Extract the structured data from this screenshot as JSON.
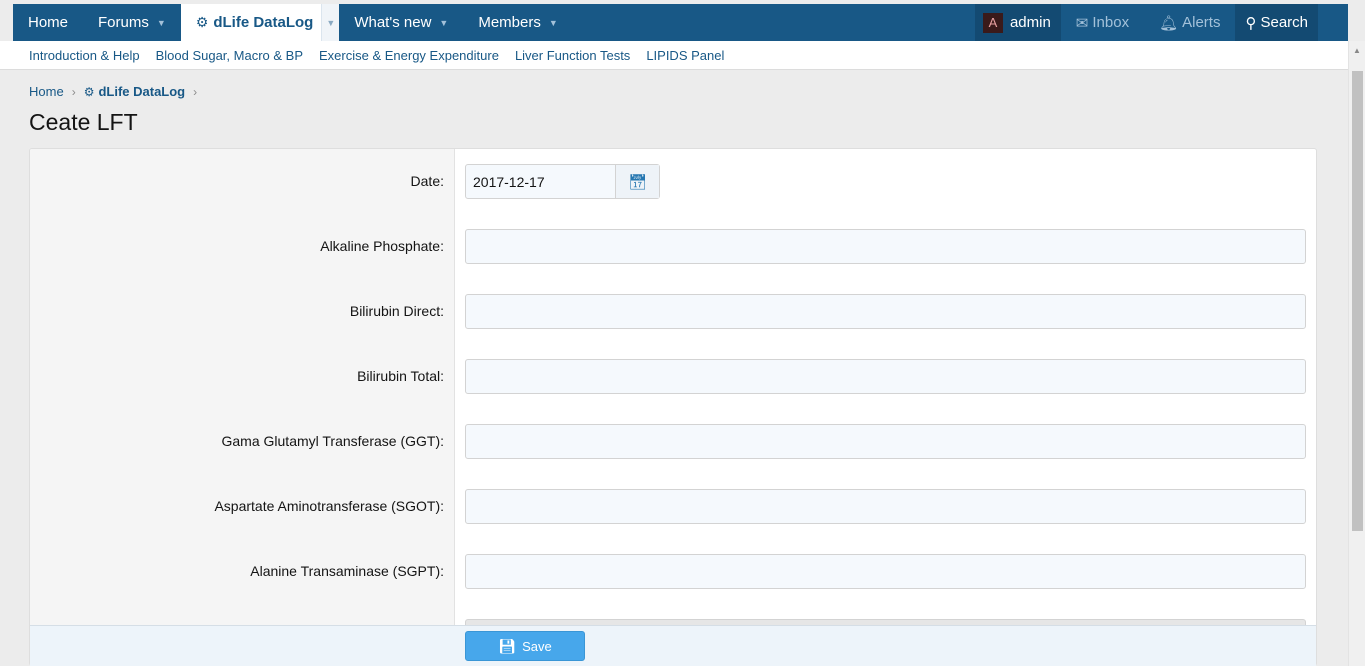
{
  "navbar": {
    "items": [
      {
        "label": "Home"
      },
      {
        "label": "Forums"
      },
      {
        "label": "dLife DataLog"
      },
      {
        "label": "What's new"
      },
      {
        "label": "Members"
      }
    ],
    "account": {
      "avatar_letter": "A",
      "username": "admin"
    },
    "inbox_label": "Inbox",
    "alerts_label": "Alerts",
    "search_label": "Search"
  },
  "subnav": {
    "links": [
      "Introduction & Help",
      "Blood Sugar, Macro & BP",
      "Exercise & Energy Expenditure",
      "Liver Function Tests",
      "LIPIDS Panel"
    ]
  },
  "breadcrumb": {
    "home": "Home",
    "section": "dLife DataLog"
  },
  "page_title": "Ceate LFT",
  "form": {
    "date": {
      "label": "Date:",
      "value": "2017-12-17"
    },
    "fields": [
      {
        "label": "Alkaline Phosphate:",
        "value": ""
      },
      {
        "label": "Bilirubin Direct:",
        "value": ""
      },
      {
        "label": "Bilirubin Total:",
        "value": ""
      },
      {
        "label": "Gama Glutamyl Transferase (GGT):",
        "value": ""
      },
      {
        "label": "Aspartate Aminotransferase (SGOT):",
        "value": ""
      },
      {
        "label": "Alanine Transaminase (SGPT):",
        "value": ""
      }
    ],
    "save_label": "Save"
  },
  "colors": {
    "navbar": "#185886",
    "save_button": "#47a7eb",
    "link": "#185886"
  }
}
